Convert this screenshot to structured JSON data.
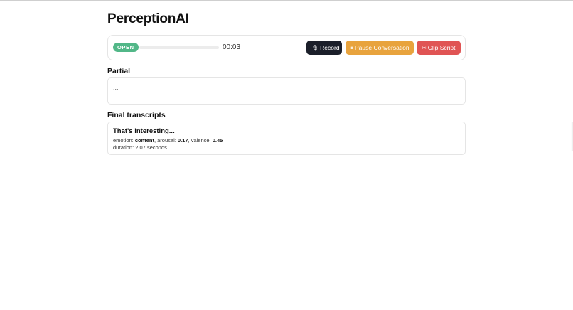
{
  "app": {
    "title": "PerceptionAI"
  },
  "toolbar": {
    "status": "OPEN",
    "progress_fraction": 0.0,
    "timer": "00:03",
    "buttons": {
      "record": {
        "icon": "microphone-icon",
        "icon_glyph": "🎙",
        "label": "Record",
        "color": "#1b1f2a"
      },
      "pause": {
        "icon": "pause-icon",
        "icon_glyph": "⏸",
        "label": "Pause Conversation",
        "color": "#e8a33d"
      },
      "clip": {
        "icon": "scissors-icon",
        "icon_glyph": "✂",
        "label": "Clip Script",
        "color": "#e05454"
      }
    },
    "status_color": "#52b788"
  },
  "partial": {
    "heading": "Partial",
    "text": "..."
  },
  "final": {
    "heading": "Final transcripts",
    "items": [
      {
        "text": "That's interesting...",
        "emotion_label": "emotion:",
        "emotion": "content",
        "arousal_label": "arousal:",
        "arousal": "0.17",
        "valence_label": "valence:",
        "valence": "0.45",
        "duration": "duration: 2.07 seconds"
      }
    ]
  }
}
